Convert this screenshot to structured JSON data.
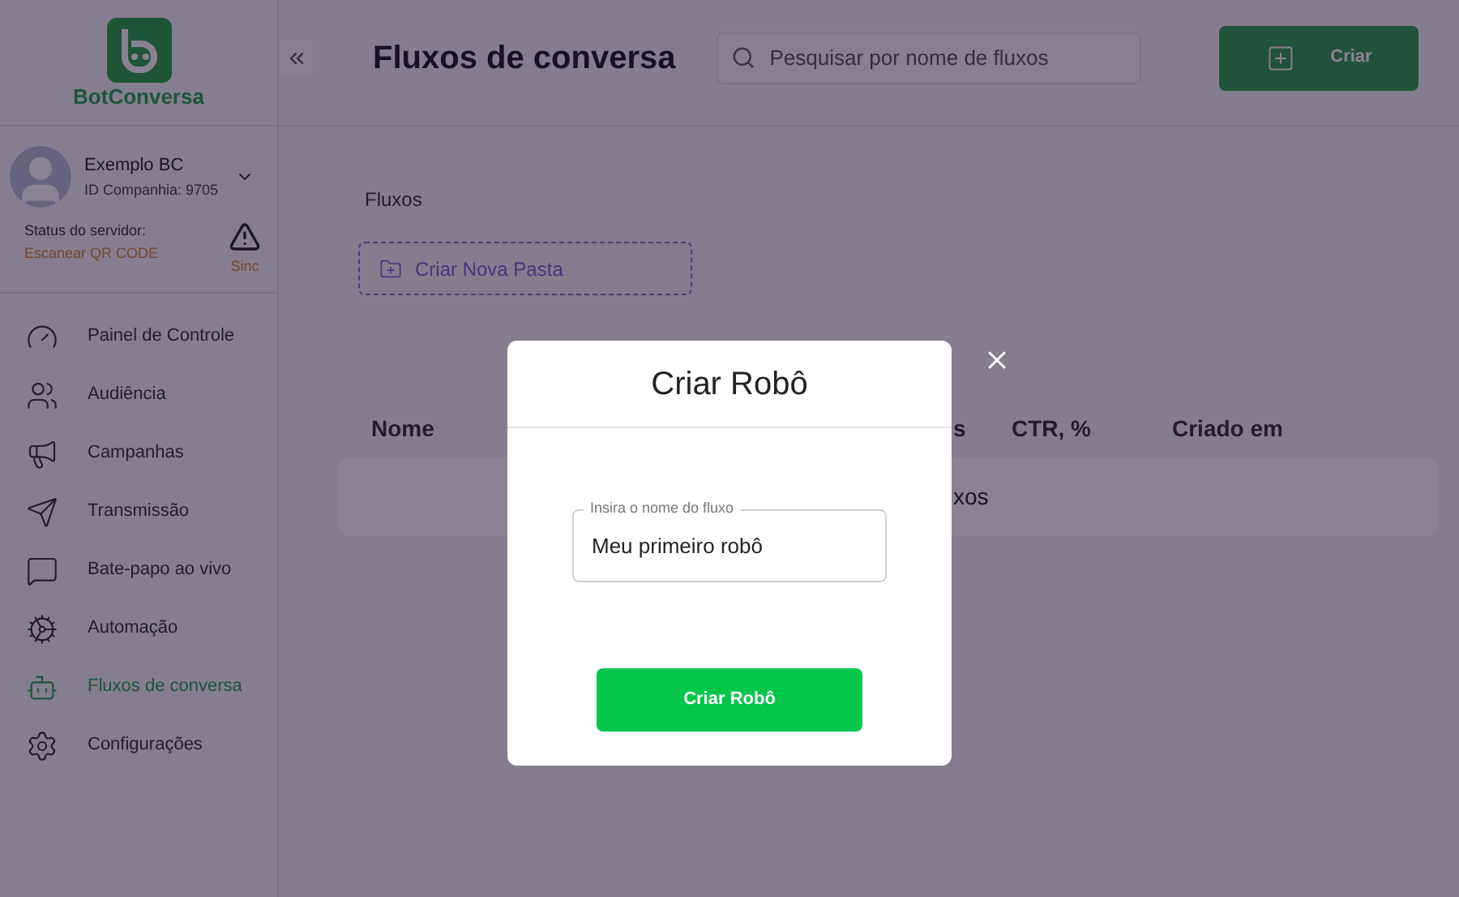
{
  "brand": {
    "name": "BotConversa"
  },
  "account": {
    "name": "Exemplo BC",
    "company_id": "ID Companhia: 9705"
  },
  "server_status": {
    "label": "Status do servidor:",
    "value": "Escanear QR CODE",
    "sync": "Sinc"
  },
  "nav": [
    {
      "label": "Painel de Controle",
      "selected": false
    },
    {
      "label": "Audiência",
      "selected": false
    },
    {
      "label": "Campanhas",
      "selected": false
    },
    {
      "label": "Transmissão",
      "selected": false
    },
    {
      "label": "Bate-papo ao vivo",
      "selected": false
    },
    {
      "label": "Automação",
      "selected": false
    },
    {
      "label": "Fluxos de conversa",
      "selected": true
    },
    {
      "label": "Configurações",
      "selected": false
    }
  ],
  "header": {
    "title": "Fluxos de conversa",
    "search": {
      "placeholder": "Pesquisar por nome de fluxos"
    },
    "create_button": "Criar"
  },
  "section": {
    "title": "Fluxos",
    "new_folder": "Criar Nova Pasta"
  },
  "table": {
    "columns": [
      "Nome",
      "s",
      "CTR, %",
      "Criado em"
    ],
    "empty_row": "xos"
  },
  "dialog": {
    "title": "Criar Robô",
    "field": {
      "label": "Insira o nome do fluxo",
      "value": "Meu primeiro robô"
    },
    "submit": "Criar Robô"
  }
}
